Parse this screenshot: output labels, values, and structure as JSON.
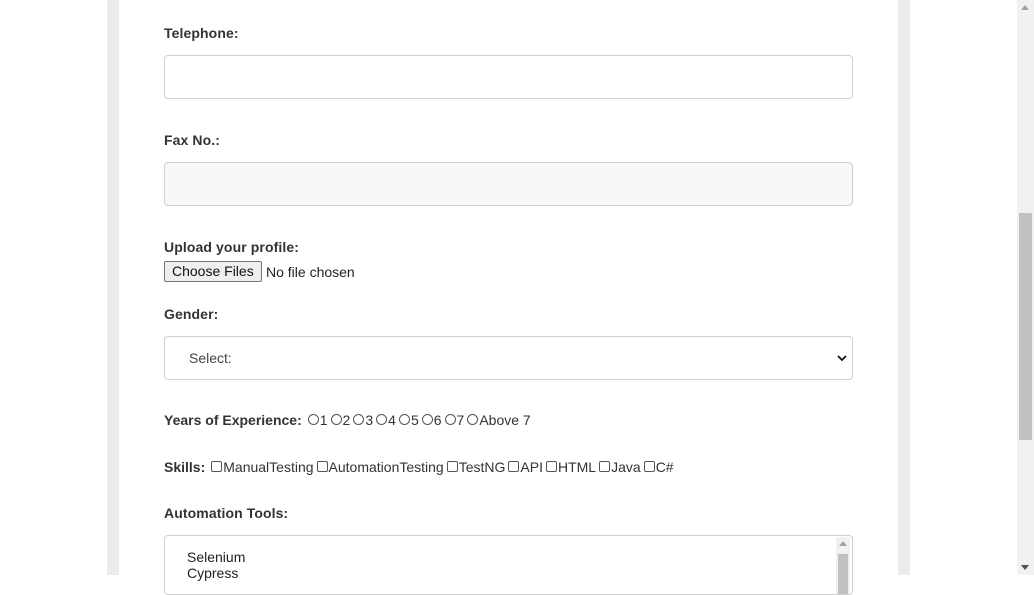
{
  "form": {
    "telephone_label": "Telephone:",
    "telephone_value": "",
    "fax_label": "Fax No.:",
    "fax_value": "",
    "upload_label": "Upload your profile:",
    "upload_button": "Choose Files",
    "upload_status": "No file chosen",
    "gender_label": "Gender:",
    "gender_selected": "Select:",
    "experience_label": "Years of Experience:",
    "experience_options": [
      "1",
      "2",
      "3",
      "4",
      "5",
      "6",
      "7",
      "Above 7"
    ],
    "skills_label": "Skills:",
    "skills_options": [
      "ManualTesting",
      "AutomationTesting",
      "TestNG",
      "API",
      "HTML",
      "Java",
      "C#"
    ],
    "tools_label": "Automation Tools:",
    "tools_options": [
      "Selenium",
      "Cypress"
    ]
  },
  "colors": {
    "page_gutter": "#ebebeb",
    "input_border": "#cfcfcf",
    "fax_input_bg": "#f7f7f7",
    "scrollbar_thumb": "#c1c1c1"
  },
  "icons": {
    "select_caret": "chevron-down-icon",
    "scroll_up": "arrow-up-icon",
    "scroll_down": "arrow-down-icon"
  }
}
